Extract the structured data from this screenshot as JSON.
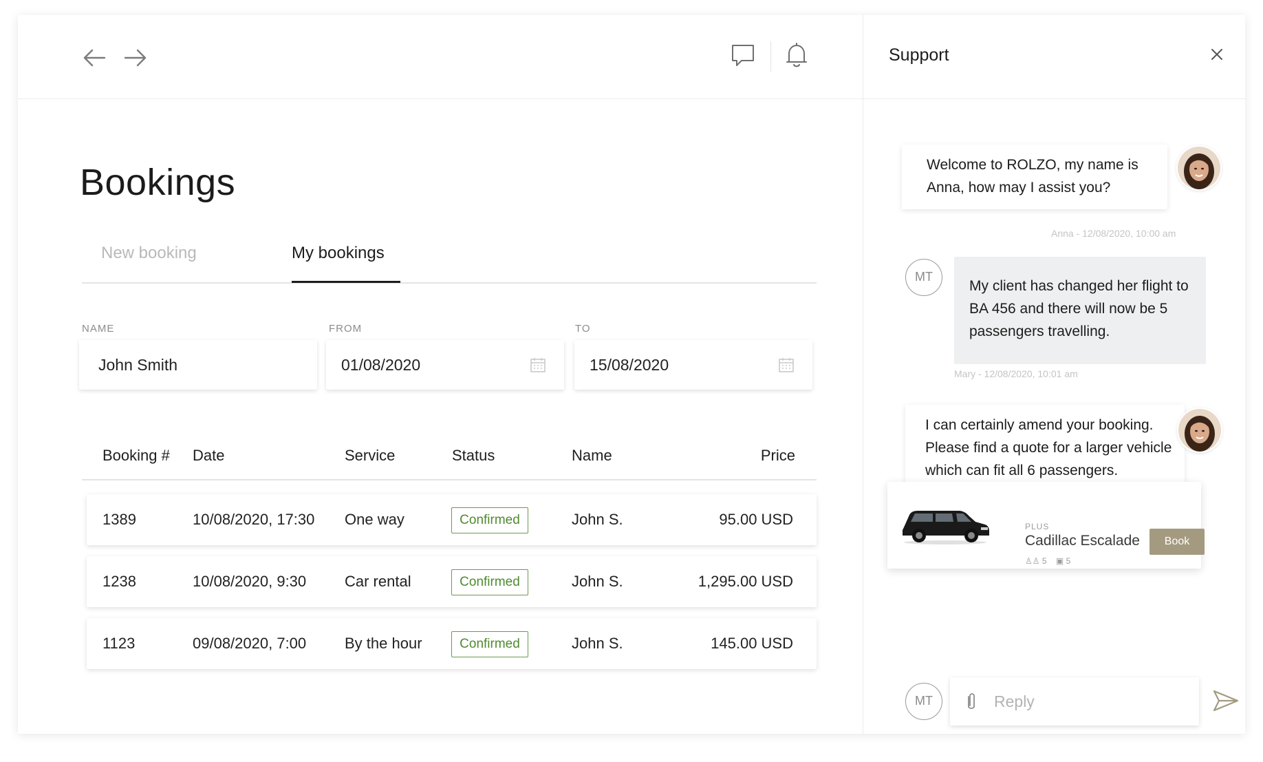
{
  "title": "Bookings",
  "tabs": [
    {
      "label": "New booking",
      "active": false
    },
    {
      "label": "My bookings",
      "active": true
    }
  ],
  "filters": {
    "name": {
      "label": "NAME",
      "value": "John Smith"
    },
    "from": {
      "label": "FROM",
      "value": "01/08/2020"
    },
    "to": {
      "label": "TO",
      "value": "15/08/2020"
    }
  },
  "table": {
    "columns": [
      "Booking #",
      "Date",
      "Service",
      "Status",
      "Name",
      "Price"
    ],
    "rows": [
      {
        "booking": "1389",
        "date": "10/08/2020, 17:30",
        "service": "One way",
        "status": "Confirmed",
        "name": "John S.",
        "price": "95.00 USD"
      },
      {
        "booking": "1238",
        "date": "10/08/2020, 9:30",
        "service": "Car rental",
        "status": "Confirmed",
        "name": "John S.",
        "price": "1,295.00 USD"
      },
      {
        "booking": "1123",
        "date": "09/08/2020, 7:00",
        "service": "By the hour",
        "status": "Confirmed",
        "name": "John S.",
        "price": "145.00 USD"
      }
    ]
  },
  "icons": {
    "back": "arrow-left-icon",
    "forward": "arrow-right-icon",
    "chat": "chat-bubble-icon",
    "notifications": "bell-icon",
    "calendar": "calendar-icon",
    "close": "close-icon",
    "attach": "paperclip-icon",
    "send": "send-icon"
  },
  "support": {
    "title": "Support",
    "messages": [
      {
        "from": "agent",
        "text": "Welcome to ROLZO, my name is Anna,  how may I assist you?",
        "meta": "Anna - 12/08/2020, 10:00 am"
      },
      {
        "from": "user",
        "initials": "MT",
        "text": "My client has changed her flight to BA 456 and there will now be 5 passengers travelling.",
        "meta": "Mary - 12/08/2020, 10:01 am"
      },
      {
        "from": "agent",
        "text": "I can certainly amend your booking. Please find a quote for a larger vehicle which can fit all 6 passengers."
      }
    ],
    "vehicle": {
      "class": "PLUS",
      "name": "Cadillac Escalade",
      "passengers": "5",
      "luggage": "5",
      "button": "Book"
    },
    "reply": {
      "initials": "MT",
      "placeholder": "Reply"
    }
  },
  "colors": {
    "confirmed": "#4f8a2f",
    "book_button": "#a39a80",
    "user_bubble": "#eeeff0"
  }
}
